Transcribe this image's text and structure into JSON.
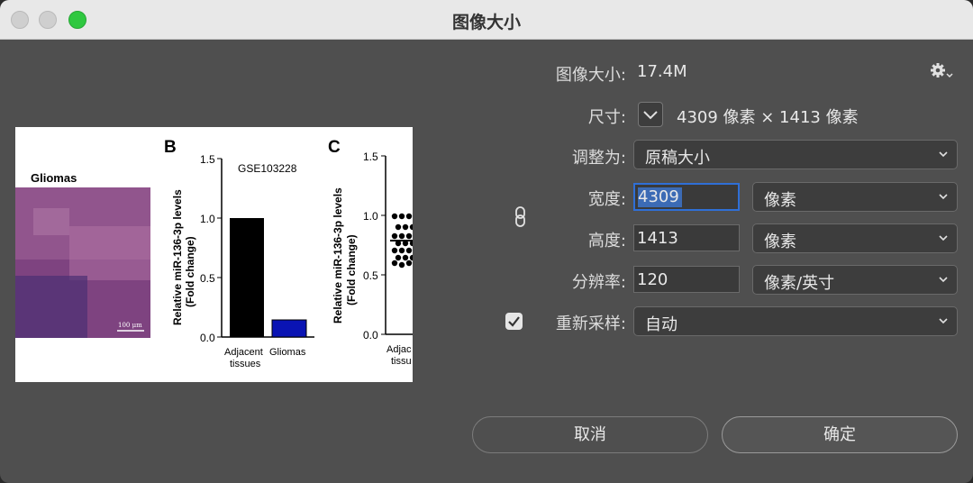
{
  "window": {
    "title": "图像大小"
  },
  "image_size": {
    "label": "图像大小:",
    "value": "17.4M"
  },
  "dimensions": {
    "label": "尺寸:",
    "value": "4309 像素  ×  1413 像素"
  },
  "fit_to": {
    "label": "调整为:",
    "value": "原稿大小"
  },
  "width": {
    "label": "宽度:",
    "value": "4309",
    "unit": "像素"
  },
  "height": {
    "label": "高度:",
    "value": "1413",
    "unit": "像素"
  },
  "resolution": {
    "label": "分辨率:",
    "value": "120",
    "unit": "像素/英寸"
  },
  "resample": {
    "label": "重新采样:",
    "value": "自动",
    "checked": true
  },
  "buttons": {
    "cancel": "取消",
    "ok": "确定"
  },
  "preview": {
    "panel_title": "Gliomas",
    "scale_bar": "100 μm",
    "b": {
      "letter": "B",
      "dataset": "GSE103228",
      "ylabel_line1": "Relative miR-136-3p levels",
      "ylabel_line2": "(Fold change)",
      "ticks": [
        "1.5",
        "1.0",
        "0.5",
        "0.0"
      ],
      "cat1_line1": "Adjacent",
      "cat1_line2": "tissues",
      "cat2": "Gliomas"
    },
    "c": {
      "letter": "C",
      "ylabel_line1": "Relative miR-136-3p levels",
      "ylabel_line2": "(Fold change)",
      "ticks": [
        "1.5",
        "1.0",
        "0.5",
        "0.0"
      ],
      "cat1_line1": "Adjac",
      "cat1_line2": "tissu"
    }
  },
  "colors": {
    "accent": "#2f6fd6",
    "bar_adjacent": "#000000",
    "bar_gliomas": "#0a14b4",
    "tissue": "#8a4a8a"
  },
  "icons": {
    "settings": "gear-icon",
    "link": "chain-link-icon",
    "chevron": "chevron-down-icon"
  }
}
